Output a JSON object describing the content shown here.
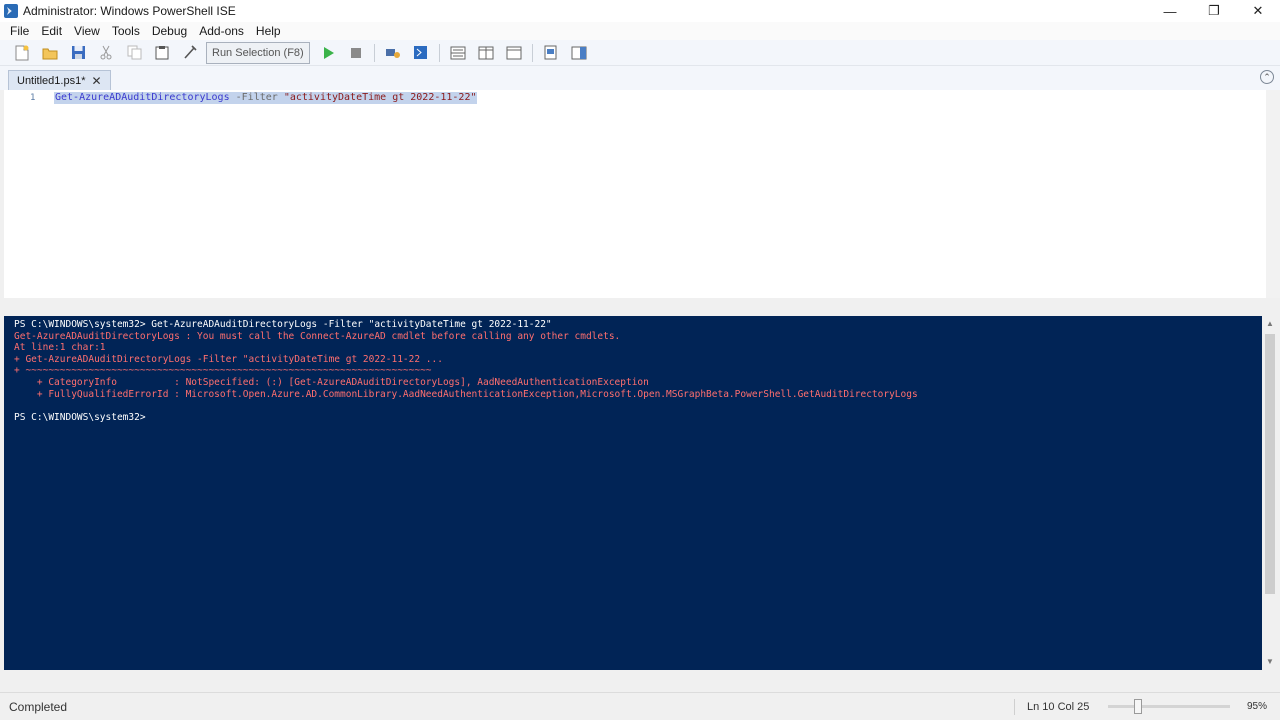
{
  "window": {
    "title": "Administrator: Windows PowerShell ISE",
    "minimize_glyph": "—",
    "maximize_glyph": "❐",
    "close_glyph": "✕"
  },
  "menu": [
    "File",
    "Edit",
    "View",
    "Tools",
    "Debug",
    "Add-ons",
    "Help"
  ],
  "toolbar": {
    "run_selection_label": "Run Selection (F8)",
    "icons": [
      "new-icon",
      "open-icon",
      "save-icon",
      "cut-icon",
      "copy-icon",
      "paste-icon",
      "clear-icon",
      "run-script-icon",
      "stop-icon",
      "remote-icon",
      "powershell-icon",
      "layout-top-icon",
      "layout-right-icon",
      "layout-max-icon",
      "show-script-icon",
      "addon-icon"
    ]
  },
  "tabs": [
    {
      "label": "Untitled1.ps1*",
      "close": "✕"
    }
  ],
  "editor": {
    "line_number": "1",
    "code": {
      "cmdlet": "Get-AzureADAuditDirectoryLogs",
      "param": "-Filter",
      "string": "\"activityDateTime gt 2022-11-22\""
    }
  },
  "console": {
    "lines": [
      {
        "text": "PS C:\\WINDOWS\\system32> Get-AzureADAuditDirectoryLogs -Filter \"activityDateTime gt 2022-11-22\"",
        "style": "white"
      },
      {
        "text": "Get-AzureADAuditDirectoryLogs : You must call the Connect-AzureAD cmdlet before calling any other cmdlets.",
        "style": "err"
      },
      {
        "text": "At line:1 char:1",
        "style": "err"
      },
      {
        "text": "+ Get-AzureADAuditDirectoryLogs -Filter \"activityDateTime gt 2022-11-22 ...",
        "style": "err"
      },
      {
        "text": "+ ~~~~~~~~~~~~~~~~~~~~~~~~~~~~~~~~~~~~~~~~~~~~~~~~~~~~~~~~~~~~~~~~~~~~~~~",
        "style": "err"
      },
      {
        "text": "    + CategoryInfo          : NotSpecified: (:) [Get-AzureADAuditDirectoryLogs], AadNeedAuthenticationException",
        "style": "err"
      },
      {
        "text": "    + FullyQualifiedErrorId : Microsoft.Open.Azure.AD.CommonLibrary.AadNeedAuthenticationException,Microsoft.Open.MSGraphBeta.PowerShell.GetAuditDirectoryLogs",
        "style": "err"
      },
      {
        "text": " ",
        "style": "white"
      },
      {
        "text": "PS C:\\WINDOWS\\system32>",
        "style": "white"
      }
    ]
  },
  "status": {
    "text": "Completed",
    "position": "Ln 10  Col 25",
    "zoom": "95%"
  }
}
